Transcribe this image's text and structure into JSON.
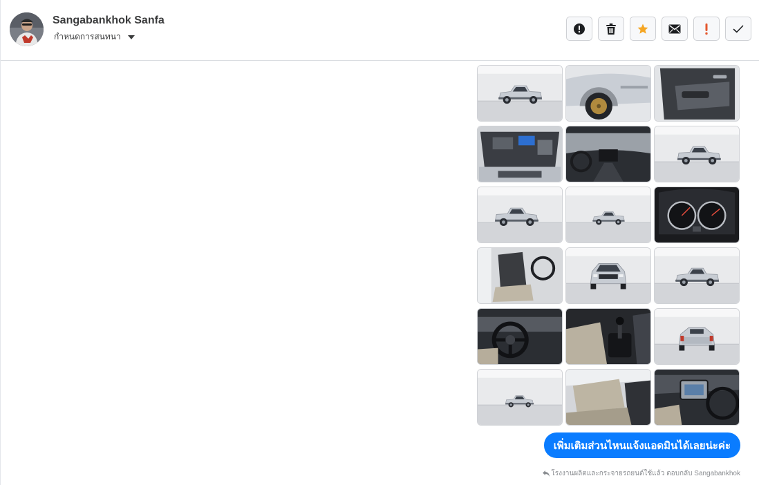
{
  "conversation": {
    "contact_name": "Sangabankhok Sanfa",
    "label_dropdown": "กำหนดการสนทนา"
  },
  "toolbar": [
    {
      "id": "spam",
      "icon": "exclamation-circle-icon"
    },
    {
      "id": "delete",
      "icon": "trash-icon"
    },
    {
      "id": "star",
      "icon": "star-icon",
      "color": "#f5a623"
    },
    {
      "id": "mark-unread",
      "icon": "envelope-icon"
    },
    {
      "id": "follow-up",
      "icon": "exclamation-icon",
      "color": "#e4572e"
    },
    {
      "id": "done",
      "icon": "checkmark-icon"
    }
  ],
  "photos": [
    {
      "subject": "pickup-front-three-quarter"
    },
    {
      "subject": "front-wheel-closeup"
    },
    {
      "subject": "door-panel-interior"
    },
    {
      "subject": "engine-bay"
    },
    {
      "subject": "dashboard-interior"
    },
    {
      "subject": "pickup-front-view"
    },
    {
      "subject": "pickup-rear-three-quarter"
    },
    {
      "subject": "pickup-side-profile"
    },
    {
      "subject": "instrument-gauges"
    },
    {
      "subject": "front-seats"
    },
    {
      "subject": "pickup-front-straight"
    },
    {
      "subject": "pickup-rear-view"
    },
    {
      "subject": "steering-wheel"
    },
    {
      "subject": "gear-shifter"
    },
    {
      "subject": "pickup-rear-straight"
    },
    {
      "subject": "pickup-side-far"
    },
    {
      "subject": "rear-seats"
    },
    {
      "subject": "center-console"
    }
  ],
  "message": {
    "text": "เพิ่มเติมส่วนไหนแจ้งแอดมินได้เลยน่ะค่ะ",
    "footnote": "โรงงานผลิตและกระจายรถยนต์ใช้แล้ว ตอบกลับ Sangabankhok",
    "bubble_color": "#0a7cff"
  }
}
